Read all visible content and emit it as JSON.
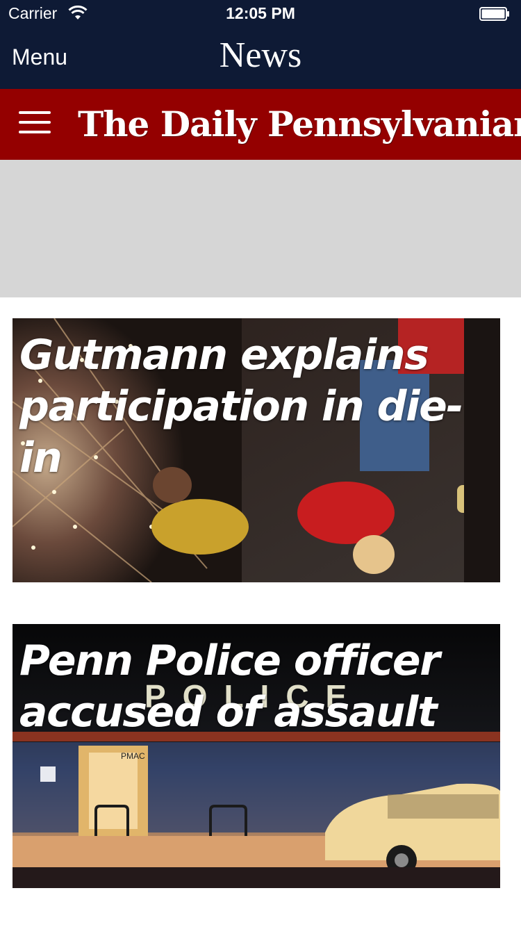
{
  "status_bar": {
    "carrier": "Carrier",
    "time": "12:05 PM",
    "wifi_icon": "wifi-icon",
    "battery_icon": "battery-icon"
  },
  "nav": {
    "menu_label": "Menu",
    "title": "News"
  },
  "brand": {
    "name": "The Daily Pennsylvanian",
    "menu_icon": "hamburger-icon",
    "color": "#940000"
  },
  "ad": {
    "background": "#d6d6d6"
  },
  "articles": [
    {
      "headline": "Gutmann explains participation in die-in"
    },
    {
      "headline": "Penn Police officer accused of assault",
      "photo_sign": "POLICE",
      "photo_door_sign": "PMAC"
    }
  ],
  "colors": {
    "nav_bg": "#0e1a35",
    "brand_bg": "#940000",
    "text_light": "#ffffff"
  }
}
